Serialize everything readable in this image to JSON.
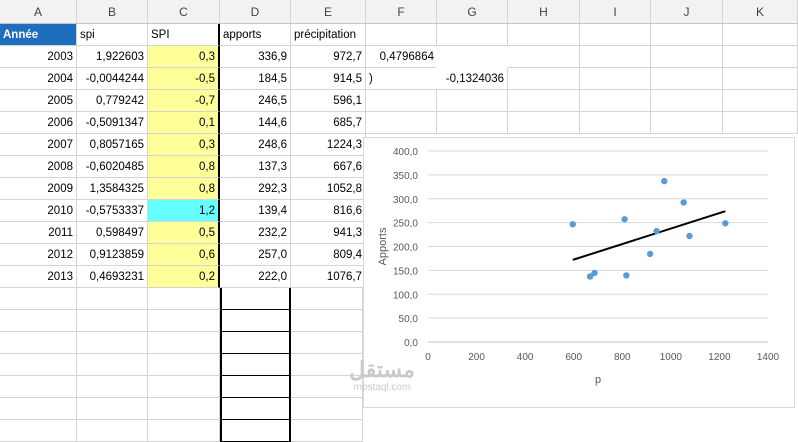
{
  "columns": [
    "A",
    "B",
    "C",
    "D",
    "E",
    "F",
    "G",
    "H",
    "I",
    "J",
    "K"
  ],
  "headers": {
    "A": "Année",
    "B": "spi",
    "C": "SPI",
    "D": "apports",
    "E": "précipitation"
  },
  "rows": [
    {
      "annee": "2003",
      "spi": "1,922603",
      "SPI": "0,3",
      "apports": "336,9",
      "precip": "972,7"
    },
    {
      "annee": "2004",
      "spi": "-0,0044244",
      "SPI": "-0,5",
      "apports": "184,5",
      "precip": "914,5"
    },
    {
      "annee": "2005",
      "spi": "0,779242",
      "SPI": "-0,7",
      "apports": "246,5",
      "precip": "596,1"
    },
    {
      "annee": "2006",
      "spi": "-0,5091347",
      "SPI": "0,1",
      "apports": "144,6",
      "precip": "685,7"
    },
    {
      "annee": "2007",
      "spi": "0,8057165",
      "SPI": "0,3",
      "apports": "248,6",
      "precip": "1224,3"
    },
    {
      "annee": "2008",
      "spi": "-0,6020485",
      "SPI": "0,8",
      "apports": "137,3",
      "precip": "667,6"
    },
    {
      "annee": "2009",
      "spi": "1,3584325",
      "SPI": "0,8",
      "apports": "292,3",
      "precip": "1052,8"
    },
    {
      "annee": "2010",
      "spi": "-0,5753337",
      "SPI": "1,2",
      "apports": "139,4",
      "precip": "816,6"
    },
    {
      "annee": "2011",
      "spi": "0,598497",
      "SPI": "0,5",
      "apports": "232,2",
      "precip": "941,3"
    },
    {
      "annee": "2012",
      "spi": "0,9123859",
      "SPI": "0,6",
      "apports": "257,0",
      "precip": "809,4"
    },
    {
      "annee": "2013",
      "spi": "0,4693231",
      "SPI": "0,2",
      "apports": "222,0",
      "precip": "1076,7"
    }
  ],
  "extra": {
    "f_row1": "0,4796864",
    "f_row2": ")",
    "g_row2": "-0,1324036"
  },
  "cell_colors": {
    "header_blue": "#1f6dbf",
    "yellow": "#ffff99",
    "cyan": "#66ffff"
  },
  "watermark": {
    "arabic": "مستقل",
    "latin": "mostaql.com"
  },
  "chart_data": {
    "type": "scatter",
    "xlabel": "p",
    "ylabel": "Apports",
    "xlim": [
      0,
      1400
    ],
    "ylim": [
      0,
      400
    ],
    "xticks": [
      "0",
      "200",
      "400",
      "600",
      "800",
      "1000",
      "1200",
      "1400"
    ],
    "yticks": [
      "0,0",
      "50,0",
      "100,0",
      "150,0",
      "200,0",
      "250,0",
      "300,0",
      "350,0",
      "400,0"
    ],
    "points": [
      {
        "x": 972.7,
        "y": 336.9
      },
      {
        "x": 914.5,
        "y": 184.5
      },
      {
        "x": 596.1,
        "y": 246.5
      },
      {
        "x": 685.7,
        "y": 144.6
      },
      {
        "x": 1224.3,
        "y": 248.6
      },
      {
        "x": 667.6,
        "y": 137.3
      },
      {
        "x": 1052.8,
        "y": 292.3
      },
      {
        "x": 816.6,
        "y": 139.4
      },
      {
        "x": 941.3,
        "y": 232.2
      },
      {
        "x": 809.4,
        "y": 257.0
      },
      {
        "x": 1076.7,
        "y": 222.0
      }
    ],
    "trendline": {
      "x1": 596.1,
      "y1": 172,
      "x2": 1224.3,
      "y2": 274
    },
    "point_color": "#5b9bd5",
    "line_color": "#000000",
    "grid": true
  }
}
